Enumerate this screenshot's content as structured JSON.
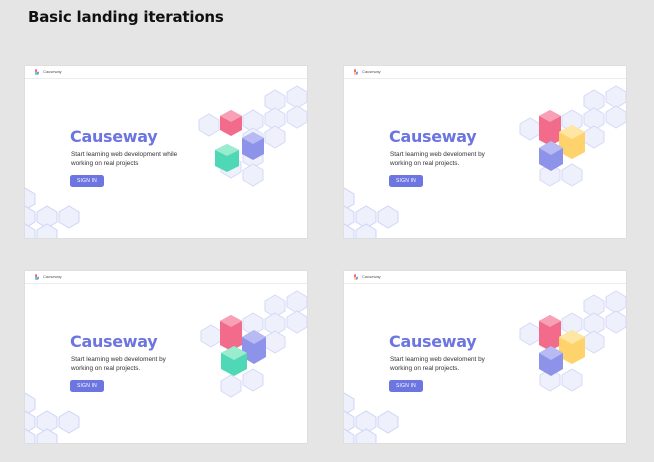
{
  "page": {
    "title": "Basic landing iterations"
  },
  "colors": {
    "accent": "#6c75e0",
    "hex_outline": "#d5daf7",
    "hex_fill": "#e7eafb",
    "pink": "#f26b8a",
    "teal": "#4fd8b6",
    "purple": "#8e93ea",
    "yellow": "#ffd36b"
  },
  "cards": [
    {
      "brand": "Causeway",
      "title": "Causeway",
      "subtitle": "Start learning web development while working on real projects",
      "button": "SIGN IN",
      "variant": "pink-teal-purple"
    },
    {
      "brand": "Causeway",
      "title": "Causeway",
      "subtitle": "Start learning web develoment by working on real projects.",
      "button": "SIGN IN",
      "variant": "pink-yellow-purple"
    },
    {
      "brand": "Causeway",
      "title": "Causeway",
      "subtitle": "Start learning web develoment by working on real projects.",
      "button": "SIGN IN",
      "variant": "pink-purple-teal"
    },
    {
      "brand": "Causeway",
      "title": "Causeway",
      "subtitle": "Start learning web develoment by working on real projects.",
      "button": "SIGN IN",
      "variant": "pink-yellow-purple"
    }
  ]
}
